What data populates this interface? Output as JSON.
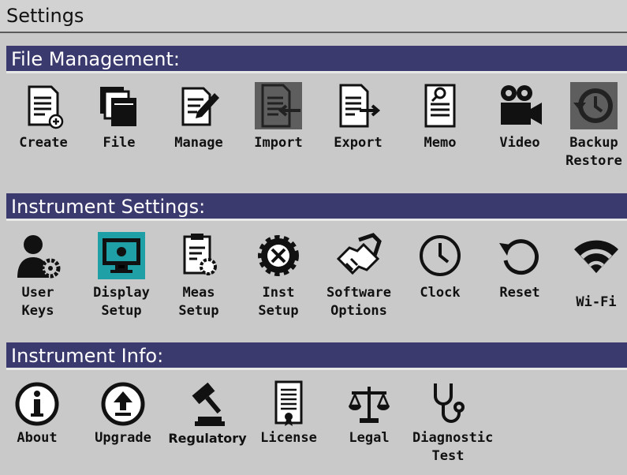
{
  "title": "Settings",
  "sections": {
    "file_management": {
      "header": "File Management:",
      "items": [
        "Create",
        "File",
        "Manage",
        "Import",
        "Export",
        "Memo",
        "Video",
        "Backup\nRestore"
      ]
    },
    "instrument_settings": {
      "header": "Instrument Settings:",
      "items": [
        "User\nKeys",
        "Display\nSetup",
        "Meas\nSetup",
        "Inst\nSetup",
        "Software\nOptions",
        "Clock",
        "Reset",
        "Wi-Fi"
      ]
    },
    "instrument_info": {
      "header": "Instrument Info:",
      "items": [
        "About",
        "Upgrade",
        "Regulatory",
        "License",
        "Legal",
        "Diagnostic\nTest"
      ]
    }
  },
  "colors": {
    "header_bg": "#3b3a6e",
    "selected_bg": "#1f9fa6",
    "panel_bg": "#c9c9c9"
  },
  "selected_item": "Display Setup"
}
